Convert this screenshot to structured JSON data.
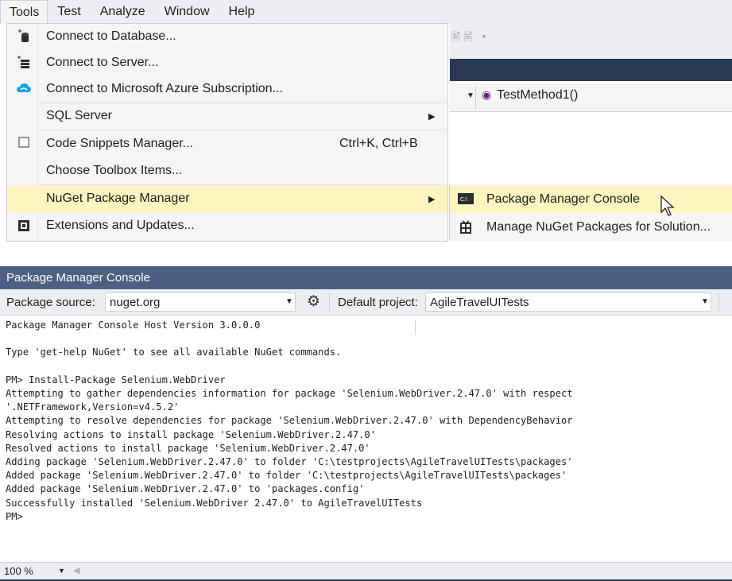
{
  "menubar": {
    "items": [
      "Tools",
      "Test",
      "Analyze",
      "Window",
      "Help"
    ]
  },
  "tools_menu": {
    "items": [
      {
        "icon": "database-connect-icon",
        "label": "Connect to Database..."
      },
      {
        "icon": "server-connect-icon",
        "label": "Connect to Server..."
      },
      {
        "icon": "azure-cloud-icon",
        "label": "Connect to Microsoft Azure Subscription..."
      },
      {
        "icon": "",
        "label": "SQL Server",
        "submenu": true
      },
      {
        "icon": "checkbox-icon",
        "label": "Code Snippets Manager...",
        "shortcut": "Ctrl+K, Ctrl+B"
      },
      {
        "icon": "",
        "label": "Choose Toolbox Items..."
      },
      {
        "icon": "",
        "label": "NuGet Package Manager",
        "submenu": true,
        "highlighted": true
      },
      {
        "icon": "extensions-icon",
        "label": "Extensions and Updates..."
      }
    ]
  },
  "submenu": {
    "items": [
      {
        "icon": "console-icon",
        "label": "Package Manager Console",
        "highlighted": true
      },
      {
        "icon": "nuget-package-icon",
        "label": "Manage NuGet Packages for Solution..."
      }
    ]
  },
  "editor_nav": {
    "method": "TestMethod1()"
  },
  "console": {
    "title": "Package Manager Console",
    "package_source_label": "Package source:",
    "package_source_value": "nuget.org",
    "default_project_label": "Default project:",
    "default_project_value": "AgileTravelUITests",
    "output_lines": [
      "Package Manager Console Host Version 3.0.0.0",
      "",
      "Type 'get-help NuGet' to see all available NuGet commands.",
      "",
      "PM> Install-Package Selenium.WebDriver",
      "Attempting to gather dependencies information for package 'Selenium.WebDriver.2.47.0' with respect",
      "'.NETFramework,Version=v4.5.2'",
      "Attempting to resolve dependencies for package 'Selenium.WebDriver.2.47.0' with DependencyBehavior",
      "Resolving actions to install package 'Selenium.WebDriver.2.47.0'",
      "Resolved actions to install package 'Selenium.WebDriver.2.47.0'",
      "Adding package 'Selenium.WebDriver.2.47.0' to folder 'C:\\testprojects\\AgileTravelUITests\\packages'",
      "Added package 'Selenium.WebDriver.2.47.0' to folder 'C:\\testprojects\\AgileTravelUITests\\packages'",
      "Added package 'Selenium.WebDriver.2.47.0' to 'packages.config'",
      "Successfully installed 'Selenium.WebDriver 2.47.0' to AgileTravelUITests",
      "PM>"
    ],
    "zoom": "100 %"
  },
  "colors": {
    "menu_highlight": "#fdf4bf",
    "title_bar": "#4d6082",
    "tab_strip": "#293955"
  }
}
